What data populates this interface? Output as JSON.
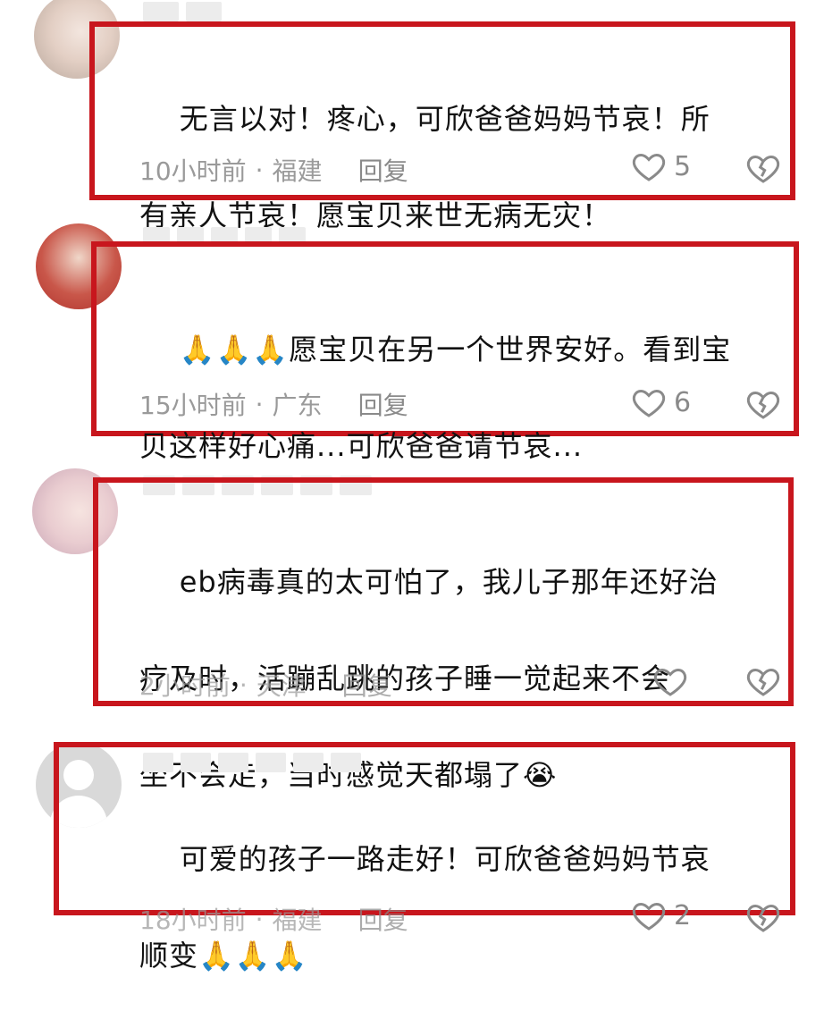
{
  "comments": [
    {
      "text": "无言以对！疼心，可欣爸爸妈妈节哀！所有亲人节哀！愿宝贝来世无病无灾！",
      "lines": [
        "无言以对！疼心，可欣爸爸妈妈节哀！所",
        "有亲人节哀！愿宝贝来世无病无灾！"
      ],
      "time": "10小时前",
      "location": "福建",
      "reply_label": "回复",
      "likes": "5"
    },
    {
      "lines": [
        "🙏🙏🙏愿宝贝在另一个世界安好。看到宝",
        "贝这样好心痛...可欣爸爸请节哀..."
      ],
      "time": "15小时前",
      "location": "广东",
      "reply_label": "回复",
      "likes": "6"
    },
    {
      "lines": [
        "eb病毒真的太可怕了，我儿子那年还好治",
        "疗及时，活蹦乱跳的孩子睡一觉起来不会",
        "坐不会走，当时感觉天都塌了😭"
      ],
      "time": "2小时前",
      "location": "天津",
      "reply_label": "回复",
      "likes": ""
    },
    {
      "lines": [
        "可爱的孩子一路走好！可欣爸爸妈妈节哀",
        "顺变🙏🙏🙏"
      ],
      "time": "18小时前",
      "location": "福建",
      "reply_label": "回复",
      "likes": "2"
    }
  ],
  "separator": "·",
  "colors": {
    "highlight_border": "#c8161d",
    "meta_text": "#9a9a9a"
  },
  "icons": {
    "like": "heart-outline-icon",
    "dislike": "broken-heart-icon"
  }
}
